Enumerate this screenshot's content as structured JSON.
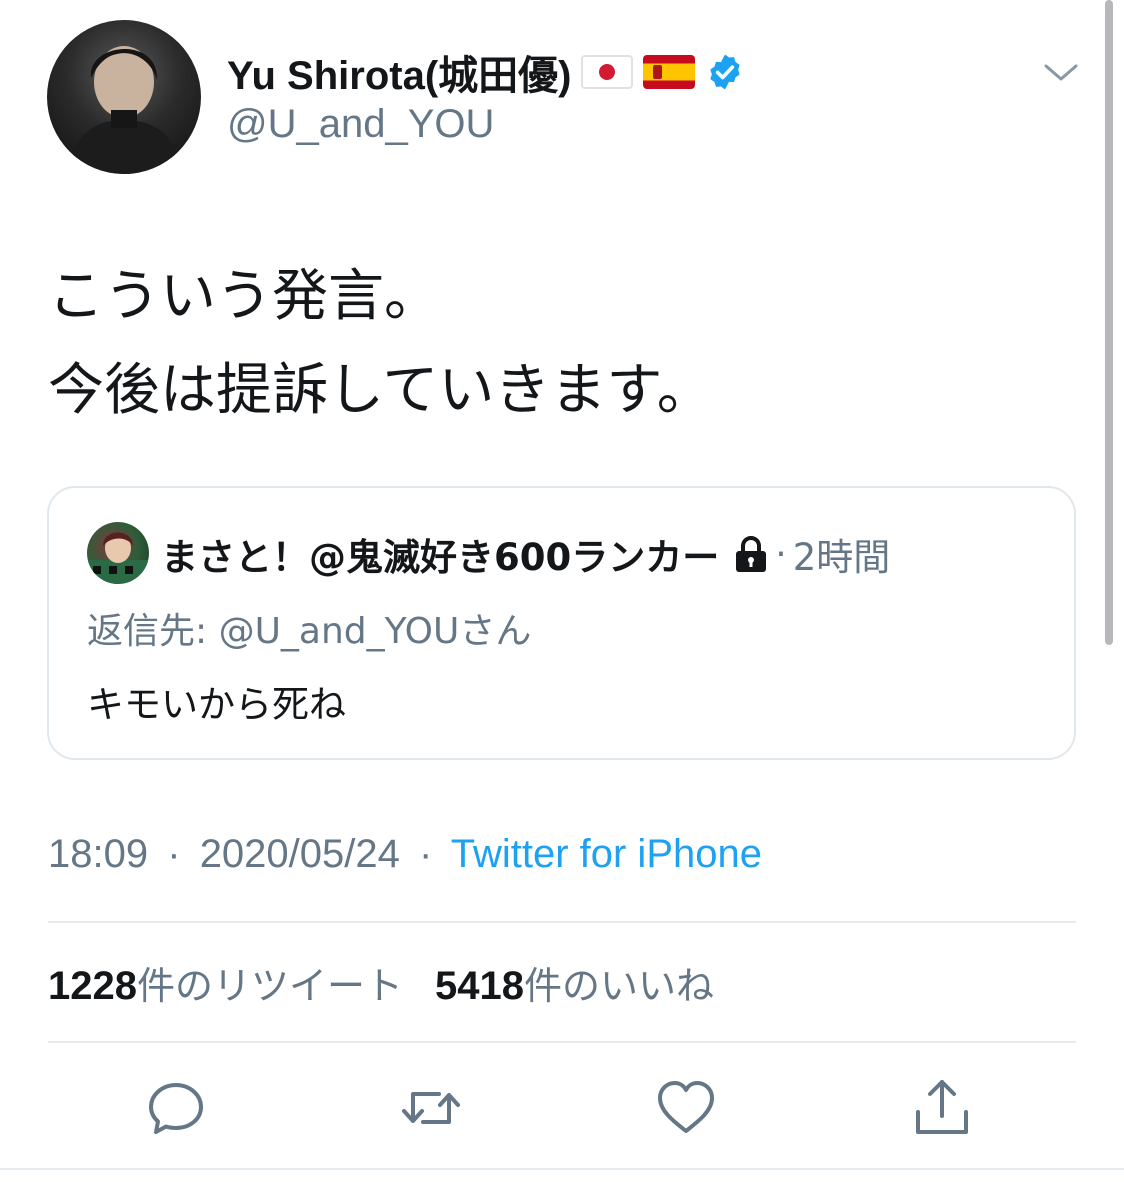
{
  "author": {
    "display_name": "Yu Shirota(城田優)",
    "handle": "@U_and_YOU",
    "avatar_icon": "profile-photo",
    "flags": [
      "japan-flag-icon",
      "spain-flag-icon"
    ],
    "verified_icon": "verified-badge-icon"
  },
  "tweet": {
    "line1": "こういう発言。",
    "line2": "今後は提訴していきます。"
  },
  "quoted": {
    "name": "まさと！@鬼滅好き600ランカー",
    "lock_icon": "lock-icon",
    "separator": "·",
    "time": "2時間",
    "reply_to": "返信先: @U_and_YOUさん",
    "text": "キモいから死ね"
  },
  "meta": {
    "time": "18:09",
    "sep1": "·",
    "date": "2020/05/24",
    "sep2": "·",
    "source": "Twitter for iPhone"
  },
  "stats": {
    "retweets_count": "1228",
    "retweets_label": "件のリツイート",
    "likes_count": "5418",
    "likes_label": "件のいいね"
  },
  "actions": [
    "reply-icon",
    "retweet-icon",
    "like-icon",
    "share-icon"
  ],
  "colors": {
    "text": "#14171a",
    "secondary": "#657786",
    "link": "#1da1f2",
    "verified": "#1da1f2",
    "border": "#e1e8ed"
  }
}
